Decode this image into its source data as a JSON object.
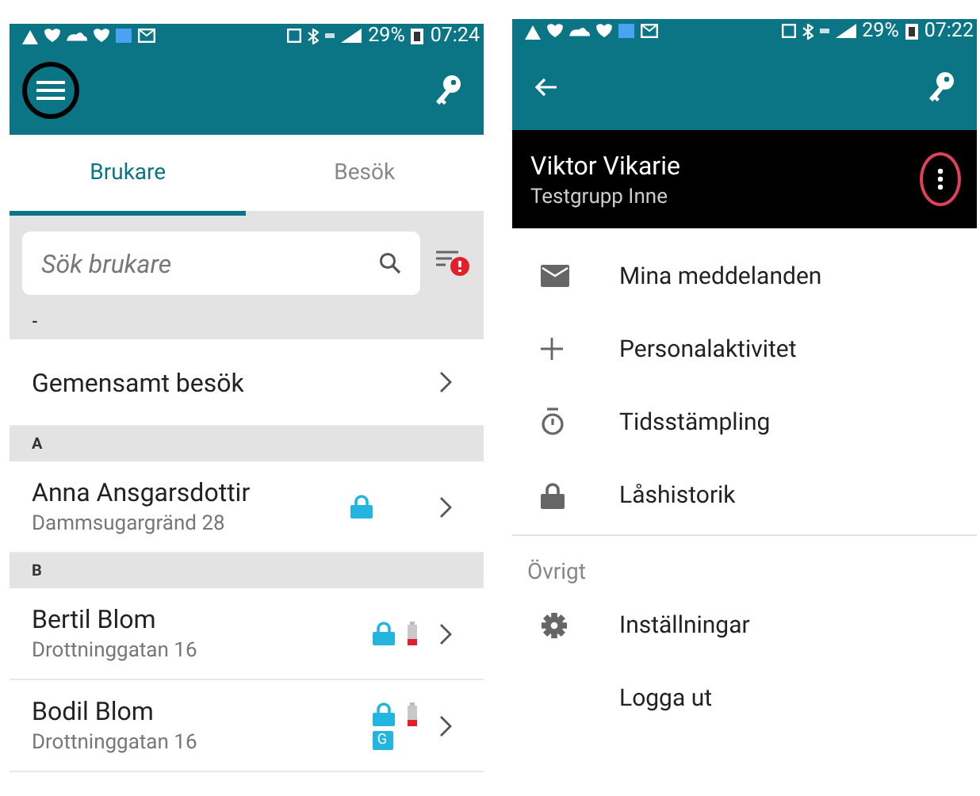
{
  "left_screen": {
    "status_bar": {
      "battery": "29%",
      "time": "07:24"
    },
    "tabs": [
      {
        "label": "Brukare",
        "selected": true
      },
      {
        "label": "Besök",
        "selected": false
      }
    ],
    "search": {
      "placeholder": "Sök brukare",
      "filter_alert": true
    },
    "list": [
      {
        "kind": "header",
        "label": "-"
      },
      {
        "kind": "entry",
        "name": "Gemensamt besök"
      },
      {
        "kind": "header",
        "label": "A"
      },
      {
        "kind": "entry",
        "name": "Anna Ansgarsdottir",
        "address": "Dammsugargränd 28",
        "badges": [
          {
            "kind": "lock"
          }
        ]
      },
      {
        "kind": "header",
        "label": "B"
      },
      {
        "kind": "entry",
        "name": "Bertil Blom",
        "address": "Drottninggatan 16",
        "badges": [
          {
            "kind": "lock"
          },
          {
            "kind": "battery_low"
          }
        ]
      },
      {
        "kind": "entry",
        "name": "Bodil Blom",
        "address": "Drottninggatan 16",
        "badges": [
          {
            "kind": "lock"
          },
          {
            "kind": "battery_low"
          },
          {
            "kind": "group_lock",
            "label": "G"
          }
        ]
      }
    ]
  },
  "right_screen": {
    "status_bar": {
      "battery": "29%",
      "time": "07:22"
    },
    "user": {
      "name": "Viktor Vikarie",
      "group": "Testgrupp Inne"
    },
    "menu": [
      {
        "kind": "mail",
        "label": "Mina meddelanden"
      },
      {
        "kind": "plus",
        "label": "Personalaktivitet"
      },
      {
        "kind": "stopwatch",
        "label": "Tidsstämpling"
      },
      {
        "kind": "lock",
        "label": "Låshistorik"
      },
      {
        "kind": "section",
        "label": "Övrigt"
      },
      {
        "kind": "gear",
        "label": "Inställningar"
      },
      {
        "kind": "plain",
        "label": "Logga ut"
      }
    ]
  }
}
